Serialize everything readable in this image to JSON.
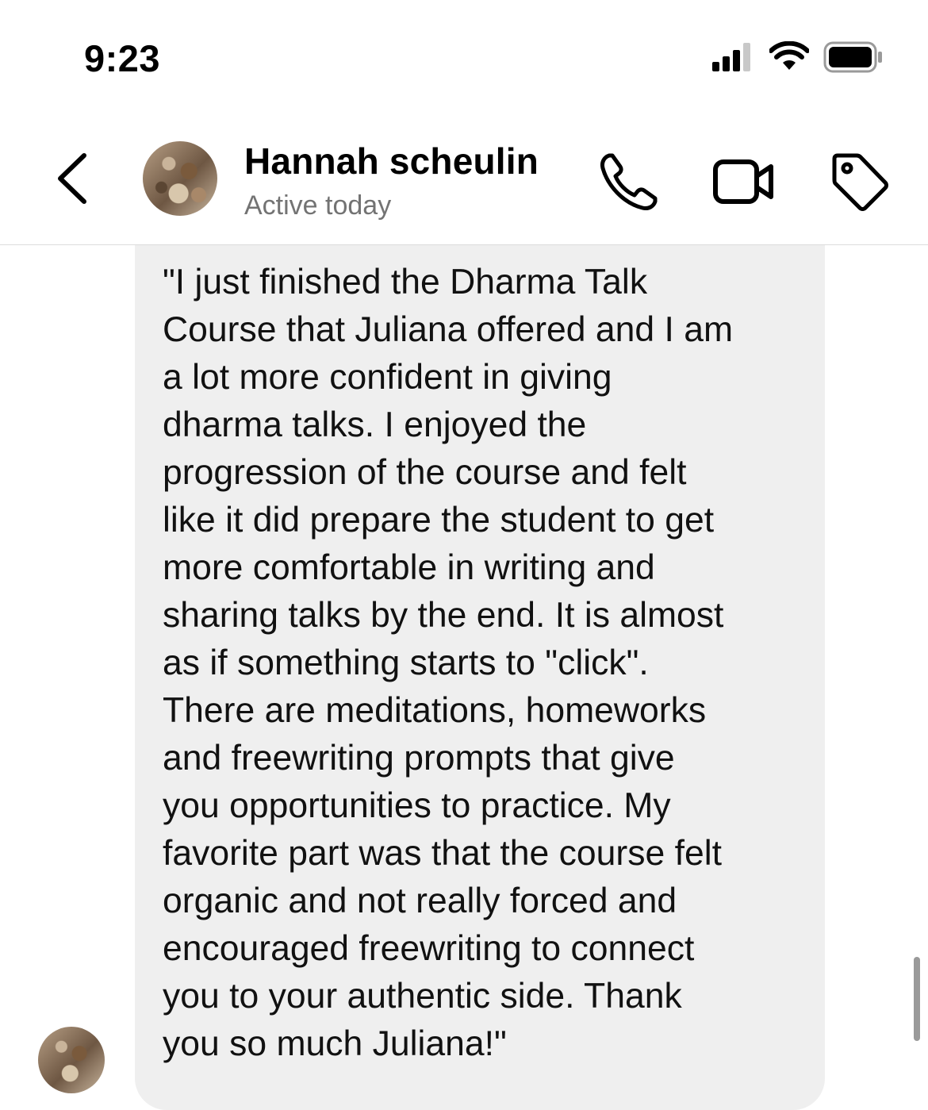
{
  "status_bar": {
    "time": "9:23"
  },
  "header": {
    "contact_name": "Hannah scheulin",
    "contact_status": "Active today",
    "icons": {
      "back": "chevron-left-icon",
      "call": "phone-icon",
      "video": "video-camera-icon",
      "tag": "tag-icon"
    }
  },
  "conversation": {
    "message_text": "\"I just finished the Dharma Talk\nCourse that Juliana offered and I am\na lot more confident in giving\ndharma talks. I enjoyed the\nprogression of the course and felt\nlike it did prepare the student to get\nmore comfortable in writing and\nsharing talks by the end. It is almost\nas if something starts to \"click\".\nThere are meditations, homeworks\nand freewriting prompts that give\nyou opportunities to practice. My\nfavorite part was that the course felt\norganic and not really forced and\nencouraged freewriting to connect\nyou to your authentic side. Thank\nyou so much Juliana!\""
  },
  "colors": {
    "bubble_background": "#efefef",
    "secondary_text": "#737373",
    "divider": "#dcdcdc"
  }
}
